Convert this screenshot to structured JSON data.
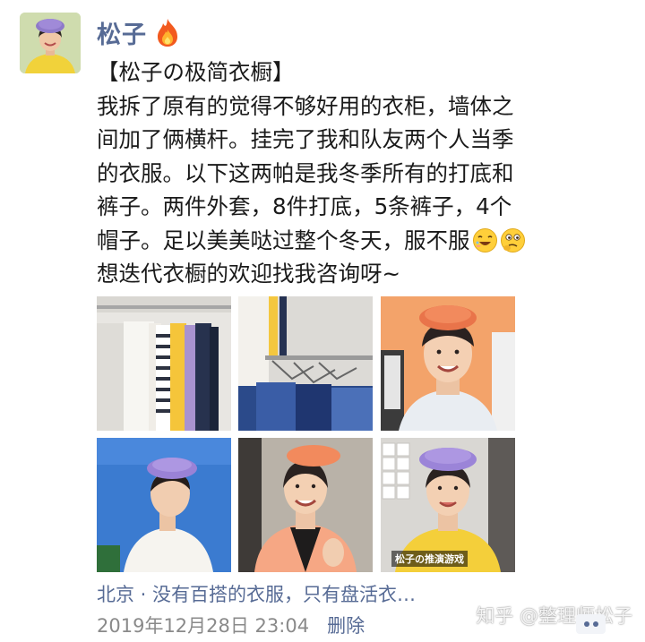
{
  "author": {
    "name": "松子",
    "badge_icon": "fire-icon"
  },
  "post": {
    "lines": [
      "【松子の极简衣橱】",
      "我拆了原有的觉得不够好用的衣柜，墙体之",
      "间加了俩横杆。挂完了我和队友两个人当季",
      "的衣服。以下这两帕是我冬季所有的打底和",
      "裤子。两件外套，8件打底，5条裤子，4个",
      "帽子。足以美美哒过整个冬天，服不服",
      "想迭代衣橱的欢迎找我咨询呀~"
    ],
    "emojis": [
      "laughing-emoji",
      "thinking-emoji"
    ]
  },
  "photos": [
    {
      "name": "photo-clothes-rack"
    },
    {
      "name": "photo-hangers-pants"
    },
    {
      "name": "photo-orange-beret-portrait"
    },
    {
      "name": "photo-purple-beret-profile"
    },
    {
      "name": "photo-peach-cardigan-heart"
    },
    {
      "name": "photo-yellow-top-video",
      "caption": "松子の推演游戏"
    }
  ],
  "location": "北京 · 没有百搭的衣服，只有盘活衣…",
  "footer": {
    "timestamp": "2019年12月28日 23:04",
    "delete_label": "删除"
  },
  "watermark": "知乎 @整理师松子",
  "colors": {
    "link": "#576b95",
    "meta": "#8a8a8a",
    "text": "#1a1a1a"
  }
}
